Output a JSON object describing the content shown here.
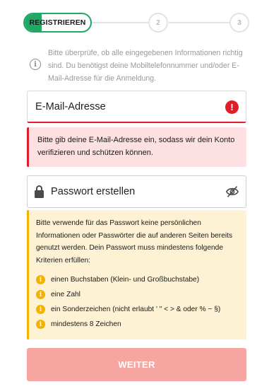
{
  "stepper": {
    "active_label": "REGISTRIEREN",
    "step2": "2",
    "step3": "3"
  },
  "info": {
    "icon": "info-icon",
    "text": "Bitte überprüfe, ob alle eingegebenen Informationen richtig sind. Du benötigst deine Mobiltelefonnummer und/oder E-Mail-Adresse für die Anmeldung."
  },
  "email": {
    "label": "E-Mail-Adresse",
    "error_icon": "!",
    "error_message": "Bitte gib deine E-Mail-Adresse ein, sodass wir dein Konto verifizieren und schützen können."
  },
  "password": {
    "label": "Passwort erstellen",
    "hint": "Bitte verwende für das Passwort keine persönlichen Informationen oder Passwörter die auf anderen Seiten bereits genutzt werden. Dein Passwort muss mindestens folgende Kriterien erfüllen:",
    "criteria": [
      "einen Buchstaben (Klein- und Großbuchstabe)",
      "eine Zahl",
      "ein Sonderzeichen (nicht erlaubt ' \" < > & oder % ~ §)",
      "mindestens 8 Zeichen"
    ]
  },
  "submit": {
    "label": "WEITER"
  },
  "colors": {
    "accent_green": "#21a865",
    "error_red": "#e01e2a",
    "warning_yellow": "#f5b100",
    "button_disabled": "#f7a5a0"
  }
}
